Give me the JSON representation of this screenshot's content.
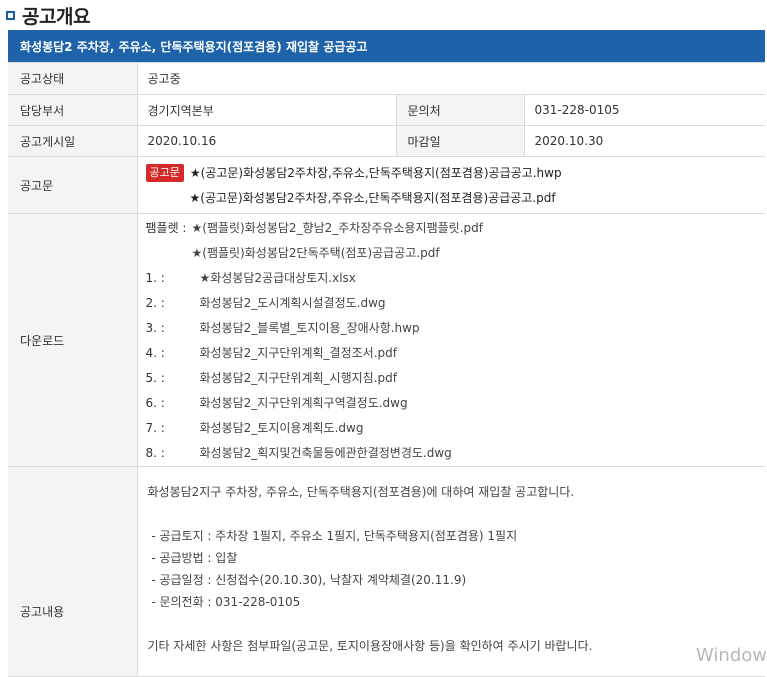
{
  "section_title": "공고개요",
  "notice_title": "화성봉담2 주차장, 주유소, 단독주택용지(점포겸용) 재입찰 공급공고",
  "rows": {
    "status": {
      "label": "공고상태",
      "value": "공고중"
    },
    "dept": {
      "label": "담당부서",
      "value": "경기지역본부",
      "contact_label": "문의처",
      "contact_value": "031-228-0105"
    },
    "dates": {
      "label": "공고게시일",
      "value": "2020.10.16",
      "deadline_label": "마감일",
      "deadline_value": "2020.10.30"
    },
    "notice_doc": {
      "label": "공고문",
      "badge": "공고문",
      "files": [
        "★(공고문)화성봉담2주차장,주유소,단독주택용지(점포겸용)공급공고.hwp",
        "★(공고문)화성봉담2주차장,주유소,단독주택용지(점포겸용)공급공고.pdf"
      ]
    },
    "download": {
      "label": "다운로드",
      "pamphlet_label": "팸플렛 :",
      "pamphlets": [
        "★(팸플릿)화성봉담2_향남2_주차장주유소용지팸플릿.pdf",
        "★(팸플릿)화성봉담2단독주택(점포)공급공고.pdf"
      ],
      "items": [
        {
          "num": "1. :",
          "file": "★화성봉담2공급대상토지.xlsx"
        },
        {
          "num": "2. :",
          "file": "화성봉담2_도시계획시설결정도.dwg"
        },
        {
          "num": "3. :",
          "file": "화성봉담2_블록별_토지이용_장애사항.hwp"
        },
        {
          "num": "4. :",
          "file": "화성봉담2_지구단위계획_결정조서.pdf"
        },
        {
          "num": "5. :",
          "file": "화성봉담2_지구단위계획_시행지침.pdf"
        },
        {
          "num": "6. :",
          "file": "화성봉담2_지구단위계획구역결정도.dwg"
        },
        {
          "num": "7. :",
          "file": "화성봉담2_토지이용계획도.dwg"
        },
        {
          "num": "8. :",
          "file": "화성봉담2_획지및건축물등에관한결정변경도.dwg"
        }
      ]
    },
    "content": {
      "label": "공고내용",
      "intro": "화성봉담2지구 주차장, 주유소, 단독주택용지(점포겸용)에 대하여 재입찰 공고합니다.",
      "bullets": [
        " - 공급토지 : 주차장 1필지, 주유소 1필지, 단독주택용지(점포겸용) 1필지",
        " - 공급방법 : 입찰",
        " - 공급일정 : 신청접수(20.10.30), 낙찰자 계약체결(20.11.9)",
        " - 문의전화 : 031-228-0105"
      ],
      "footer": "기타 자세한 사항은 첨부파일(공고문, 토지이용장애사항 등)을 확인하여 주시기 바랍니다."
    }
  },
  "watermark": "Window"
}
